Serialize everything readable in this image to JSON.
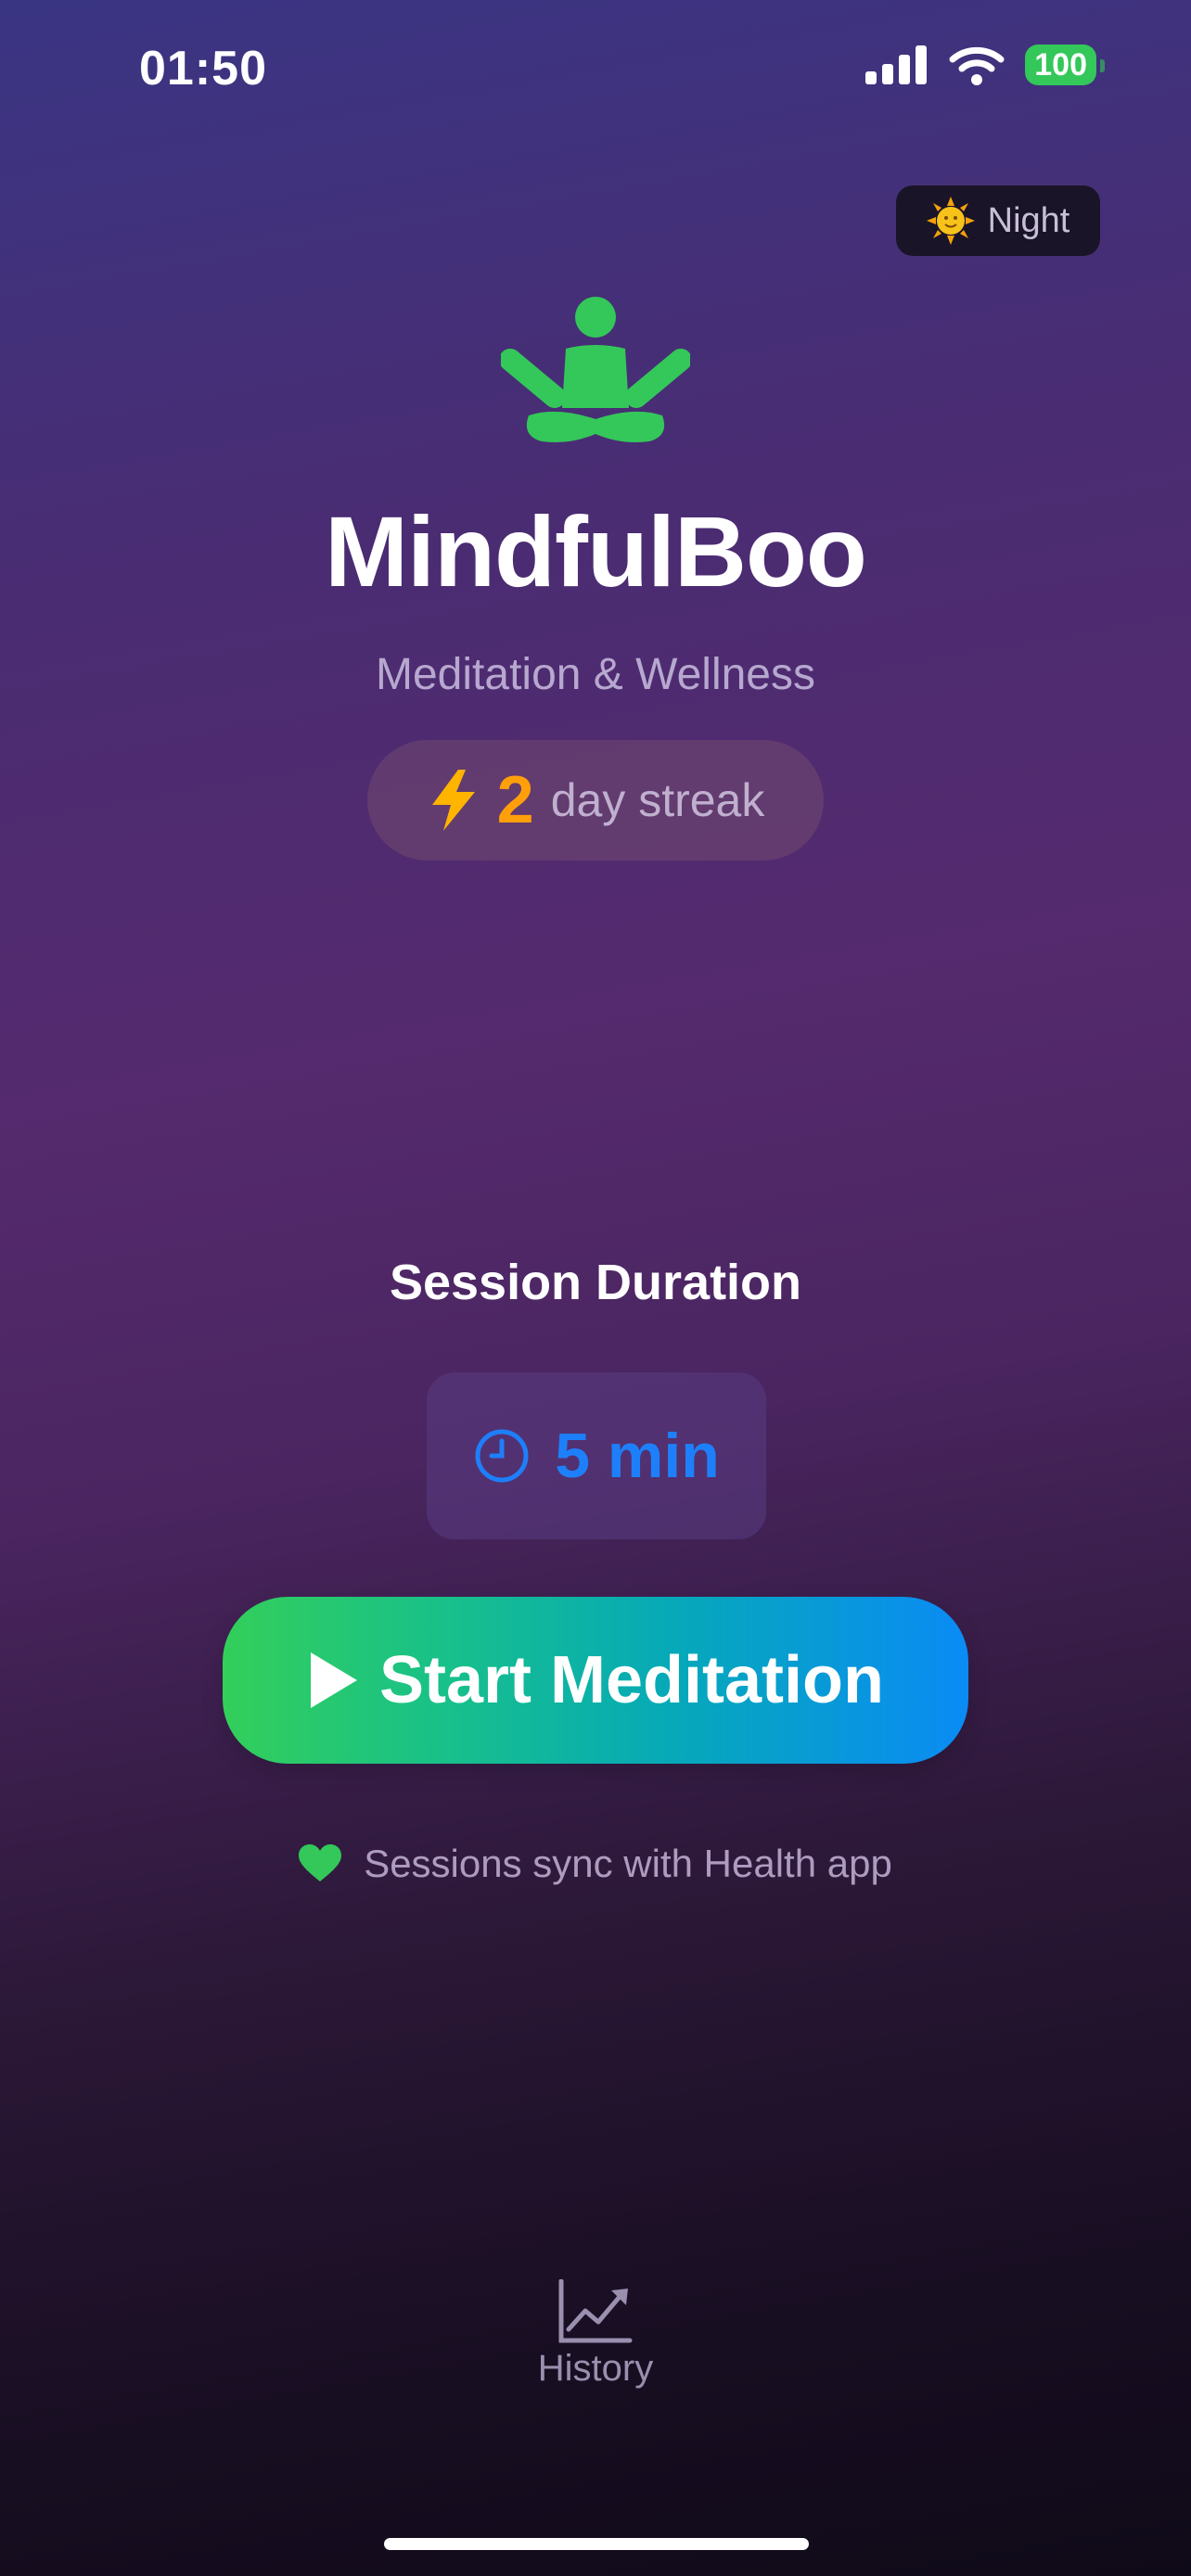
{
  "status_bar": {
    "time": "01:50",
    "battery": "100"
  },
  "theme_toggle": {
    "label": "Night",
    "icon": "sun-face-icon"
  },
  "hero": {
    "icon": "meditation-person-icon",
    "title": "MindfulBoo",
    "subtitle": "Meditation & Wellness"
  },
  "streak": {
    "icon": "lightning-bolt-icon",
    "count": "2",
    "label": "day streak"
  },
  "session": {
    "title": "Session Duration",
    "duration": {
      "icon": "clock-icon",
      "value": "5 min"
    },
    "start_button": {
      "icon": "play-icon",
      "label": "Start Meditation"
    }
  },
  "sync_note": {
    "icon": "heart-icon",
    "text": "Sessions sync with Health app"
  },
  "tab_bar": {
    "history": {
      "icon": "chart-trend-icon",
      "label": "History"
    }
  },
  "colors": {
    "accent_green": "#34c759",
    "accent_blue": "#1e7ffa",
    "streak_orange": "#ff9f0a"
  }
}
